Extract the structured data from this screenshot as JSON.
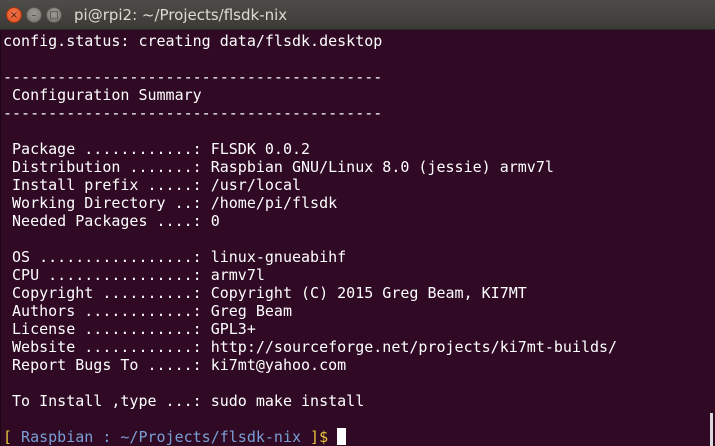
{
  "window": {
    "title": "pi@rpi2: ~/Projects/flsdk-nix",
    "close_label": "×",
    "minimize_label": "–",
    "maximize_label": "□"
  },
  "terminal": {
    "lines": [
      "config.status: creating data/flsdk.desktop",
      "",
      "------------------------------------------",
      " Configuration Summary",
      "------------------------------------------",
      "",
      " Package ............: FLSDK 0.0.2",
      " Distribution .......: Raspbian GNU/Linux 8.0 (jessie) armv7l",
      " Install prefix .....: /usr/local",
      " Working Directory ..: /home/pi/flsdk",
      " Needed Packages ....: 0",
      "",
      " OS .................: linux-gnueabihf",
      " CPU ................: armv7l",
      " Copyright ..........: Copyright (C) 2015 Greg Beam, KI7MT",
      " Authors ............: Greg Beam",
      " License ............: GPL3+",
      " Website ............: http://sourceforge.net/projects/ki7mt-builds/",
      " Report Bugs To .....: ki7mt@yahoo.com",
      "",
      " To Install ,type ...: sudo make install",
      ""
    ],
    "prompt": {
      "open": "[",
      "text": " Raspbian : ~/Projects/flsdk-nix ",
      "close": "]$"
    }
  },
  "colors": {
    "background": "#300a24",
    "prompt_bracket": "#e8c43a",
    "prompt_text": "#7a9fd6"
  }
}
